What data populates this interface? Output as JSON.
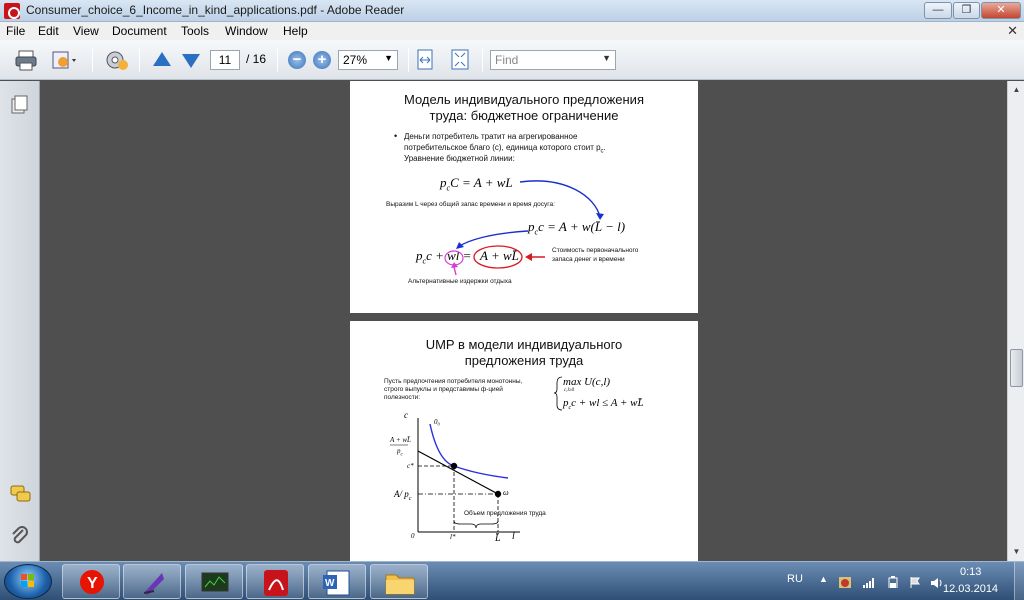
{
  "window": {
    "title": "Consumer_choice_6_Income_in_kind_applications.pdf - Adobe Reader",
    "minimize_label": "—",
    "maximize_label": "❐",
    "close_label": "✕"
  },
  "menu": {
    "items": [
      "File",
      "Edit",
      "View",
      "Document",
      "Tools",
      "Window",
      "Help"
    ],
    "close_label": "✕"
  },
  "toolbar": {
    "page_current": "11",
    "page_total": "/ 16",
    "zoom": "27%",
    "find_placeholder": "Find"
  },
  "page1": {
    "title_line1": "Модель индивидуального предложения",
    "title_line2": "труда: бюджетное ограничение",
    "bullet": "•",
    "text_line1": "Деньги потребитель тратит на агрегированное",
    "text_line2": "потребительское благо (c), единица которого стоит p",
    "text_line2_sub": "c",
    "text_line2_end": ".",
    "text_line3": "Уравнение бюджетной линии:",
    "eq1": "p",
    "eq1_sub": "c",
    "eq1_rest": "C = A + wL",
    "express_note": "Выразим L через общий запас времени и время досуга:",
    "eq2": "p",
    "eq2_sub": "c",
    "eq2_rest": "c = A + w(L̄ − l)",
    "eq3_left": "p",
    "eq3_left_sub": "c",
    "eq3_mid": "c + wl =",
    "eq3_right": "A + wL̄",
    "cost_note_line1": "Стоимость первоначального",
    "cost_note_line2": "запаса денег и времени",
    "alt_note": "Альтернативные издержки отдыха"
  },
  "page2": {
    "title_line1": "UMP в модели индивидуального",
    "title_line2": "предложения труда",
    "desc_line1": "Пусть предпочтения потребителя монотонны,",
    "desc_line2": "строго выпуклы и представимы ф-цией",
    "desc_line3": "полезности:",
    "ump_max": "max U(c,l)",
    "ump_sub": "c,l≥0",
    "ump_constraint": "p",
    "ump_constraint_sub": "c",
    "ump_constraint_rest": "c + wl ≤ A + wL̄",
    "graph": {
      "y_axis_label": "c",
      "x_axis_label": "l",
      "origin_label": "0",
      "curve_label": "0₀",
      "y_tick_top_num": "A + wL̄",
      "y_tick_top_den": "p",
      "y_tick_top_den_sub": "c",
      "y_tick_cstar": "c*",
      "y_tick_endow": "A/ p",
      "y_tick_endow_sub": "c",
      "x_tick_lstar": "l*",
      "x_tick_Lbar": "L̄",
      "omega_label": "ω",
      "brace_label": "Объем предложения труда"
    }
  },
  "taskbar": {
    "lang": "RU",
    "time": "0:13",
    "date": "12.03.2014"
  }
}
